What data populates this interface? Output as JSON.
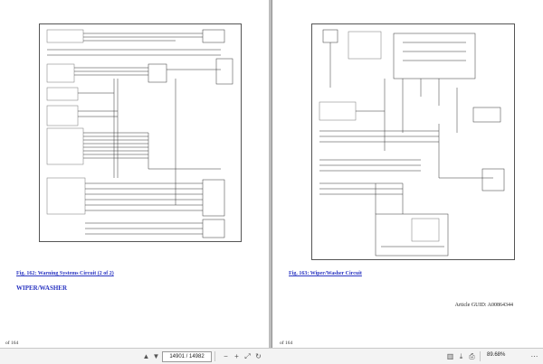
{
  "left_page": {
    "caption": "Fig. 162: Warning Systems Circuit (2 of 2)",
    "section_heading": "WIPER/WASHER",
    "footer": "of 164"
  },
  "right_page": {
    "caption": "Fig. 163: Wiper/Washer Circuit",
    "article_guid": "Article GUID: A00864344",
    "footer": "of 164"
  },
  "toolbar": {
    "page_indicator": "14901 / 14982",
    "zoom": "89.68%",
    "icons": [
      "page-up-icon",
      "page-down-icon",
      "zoom-out-icon",
      "zoom-in-icon",
      "fit-page-icon",
      "rotate-icon",
      "two-page-icon",
      "download-icon",
      "print-icon",
      "more-icon"
    ]
  },
  "colors": {
    "link": "#2b36c2",
    "background": "#8f8f8f"
  }
}
